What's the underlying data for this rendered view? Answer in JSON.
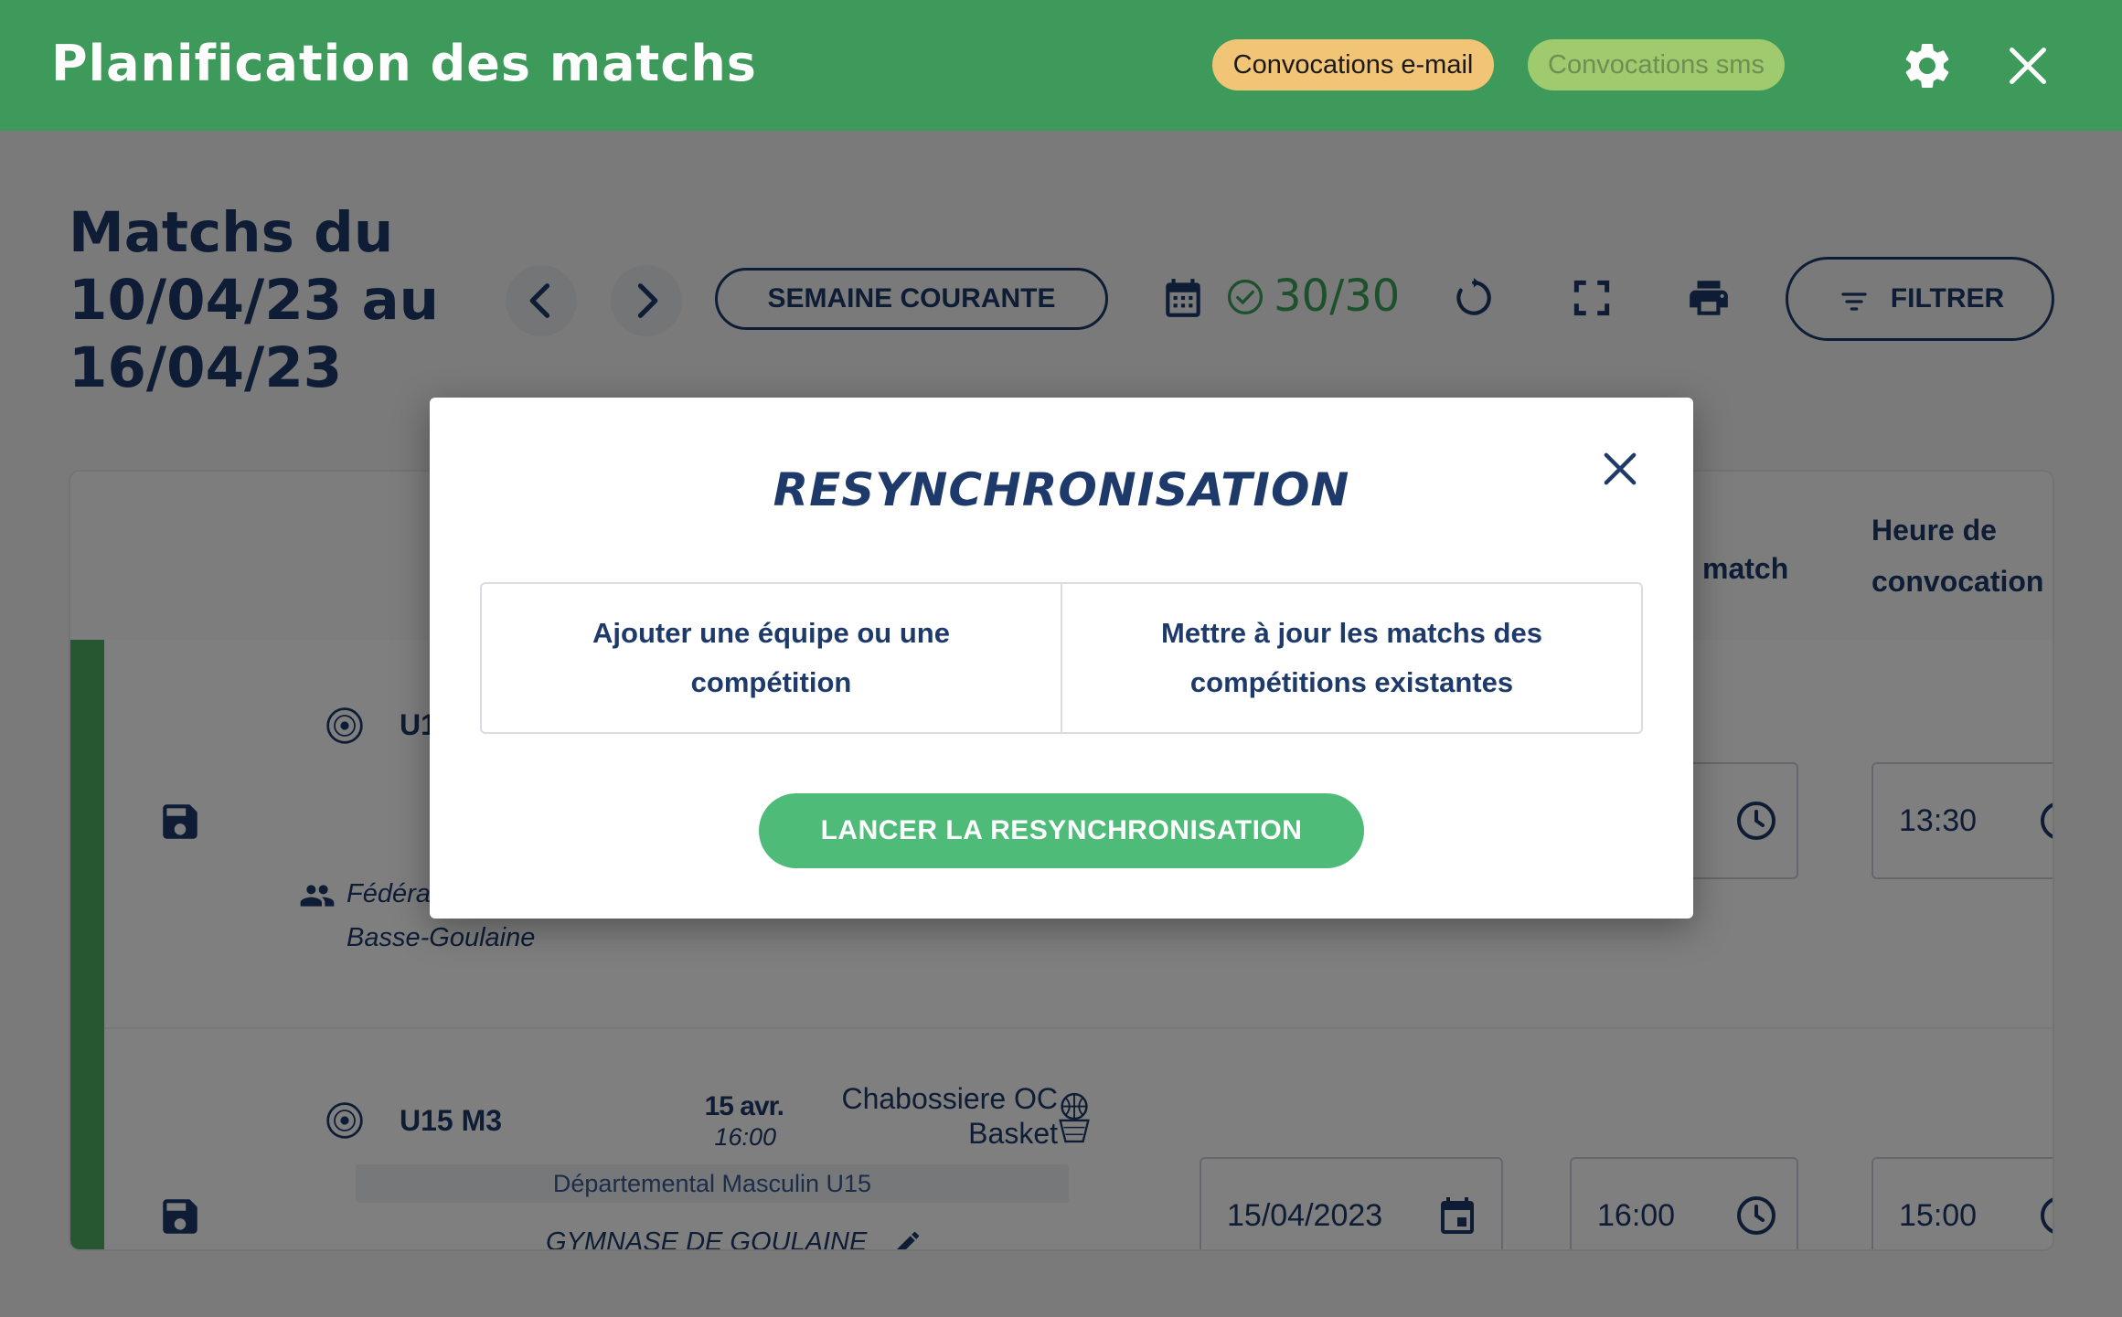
{
  "app": {
    "title": "Planification des matchs"
  },
  "topbar": {
    "email_pill": "Convocations e-mail",
    "sms_pill": "Convocations sms",
    "settings_icon": "gear-icon",
    "close_icon": "close-icon"
  },
  "header": {
    "week_title_line1": "Matchs du",
    "week_title_line2": "10/04/23 au",
    "week_title_line3": "16/04/23",
    "current_week_label": "SEMAINE COURANTE",
    "counter": "30/30",
    "filter_label": "FILTRER"
  },
  "table": {
    "columns": {
      "match_fragment": "match",
      "convocation_line1": "Heure de",
      "convocation_line2": "convocation"
    },
    "rows": [
      {
        "team_fragment": "U1",
        "federation_fragment": "Fédéra",
        "location_line": "Basse-Goulaine",
        "convocation_time": "13:30"
      },
      {
        "team": "U15 M3",
        "date_short": "15 avr.",
        "time_short": "16:00",
        "opponent_line1": "Chabossiere OC",
        "opponent_line2": "Basket",
        "competition": "Départemental Masculin U15",
        "venue": "GYMNASE DE GOULAINE",
        "match_date": "15/04/2023",
        "match_time": "16:00",
        "convocation_time": "15:00"
      }
    ]
  },
  "modal": {
    "title": "RESYNCHRONISATION",
    "option_add": "Ajouter une équipe ou une compétition",
    "option_update": "Mettre à jour les matchs des compétitions existantes",
    "launch_label": "LANCER LA RESYNCHRONISATION"
  },
  "colors": {
    "brand_green": "#3e9a5a",
    "navy": "#1d3a6b",
    "accent_green": "#4fbb79",
    "pill_orange": "#f2c475",
    "pill_green": "#9fca6d"
  }
}
